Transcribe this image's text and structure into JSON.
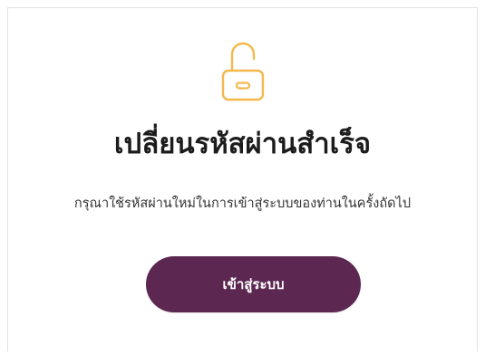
{
  "icon": {
    "name": "unlocked-padlock-icon",
    "color": "#f5b84b"
  },
  "content": {
    "title": "เปลี่ยนรหัสผ่านสำเร็จ",
    "subtitle": "กรุณาใช้รหัสผ่านใหม่ในการเข้าสู่ระบบของท่านในครั้งถัดไป"
  },
  "actions": {
    "login_label": "เข้าสู่ระบบ",
    "button_color": "#5c2751"
  }
}
